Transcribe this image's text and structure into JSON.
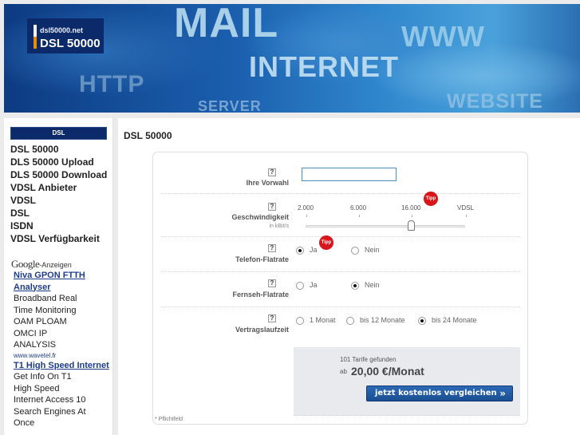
{
  "banner": {
    "words": [
      "MAIL",
      "WWW",
      "INTERNET",
      "HTTP",
      "SERVER",
      "WEBSITE"
    ],
    "logo": {
      "domain": "dsl50000.net",
      "title": "DSL 50000"
    }
  },
  "sidebar": {
    "heading": "DSL",
    "items": [
      {
        "label": "DSL 50000"
      },
      {
        "label": "DLS 50000 Upload"
      },
      {
        "label": "DLS 50000 Download"
      },
      {
        "label": "VDSL Anbieter"
      },
      {
        "label": "VDSL"
      },
      {
        "label": "DSL"
      },
      {
        "label": "ISDN"
      },
      {
        "label": "VDSL Verfügbarkeit"
      }
    ],
    "ads": {
      "brand": "Google",
      "suffix": "-Anzeigen",
      "entries": [
        {
          "title": "Niva GPON FTTH Analyser",
          "lines": [
            "Broadband Real",
            "Time Monitoring",
            "OAM PLOAM",
            "OMCI IP",
            "ANALYSIS"
          ],
          "url": "www.wavetel.fr"
        },
        {
          "title": "T1 High Speed Internet",
          "lines": [
            "Get Info On T1",
            "High Speed",
            "Internet Access 10",
            "Search Engines At",
            "Once"
          ]
        }
      ]
    }
  },
  "main": {
    "title": "DSL 50000",
    "form": {
      "help_icon": "?",
      "vorwahl": {
        "label": "Ihre Vorwahl",
        "value": ""
      },
      "speed": {
        "label": "Geschwindigkeit",
        "unit": "in kBit/s",
        "ticks": [
          "2.000",
          "6.000",
          "16.000",
          "VDSL"
        ],
        "selected": "16.000",
        "tipp": "Tipp"
      },
      "telefon": {
        "label": "Telefon-Flatrate",
        "options": [
          "Ja",
          "Nein"
        ],
        "selected": "Ja",
        "tipp": "Tipp"
      },
      "fernseh": {
        "label": "Fernseh-Flatrate",
        "options": [
          "Ja",
          "Nein"
        ],
        "selected": "Nein"
      },
      "laufzeit": {
        "label": "Vertragslaufzeit",
        "options": [
          "1 Monat",
          "bis 12 Monate",
          "bis 24 Monate"
        ],
        "selected": "bis 24 Monate"
      },
      "result": {
        "found": "101 Tarife gefunden",
        "ab": "ab",
        "price": "20,00 €/Monat",
        "button": "jetzt kostenlos vergleichen",
        "button_icon": "»"
      },
      "footnote": "* Pflichtfeld"
    }
  }
}
